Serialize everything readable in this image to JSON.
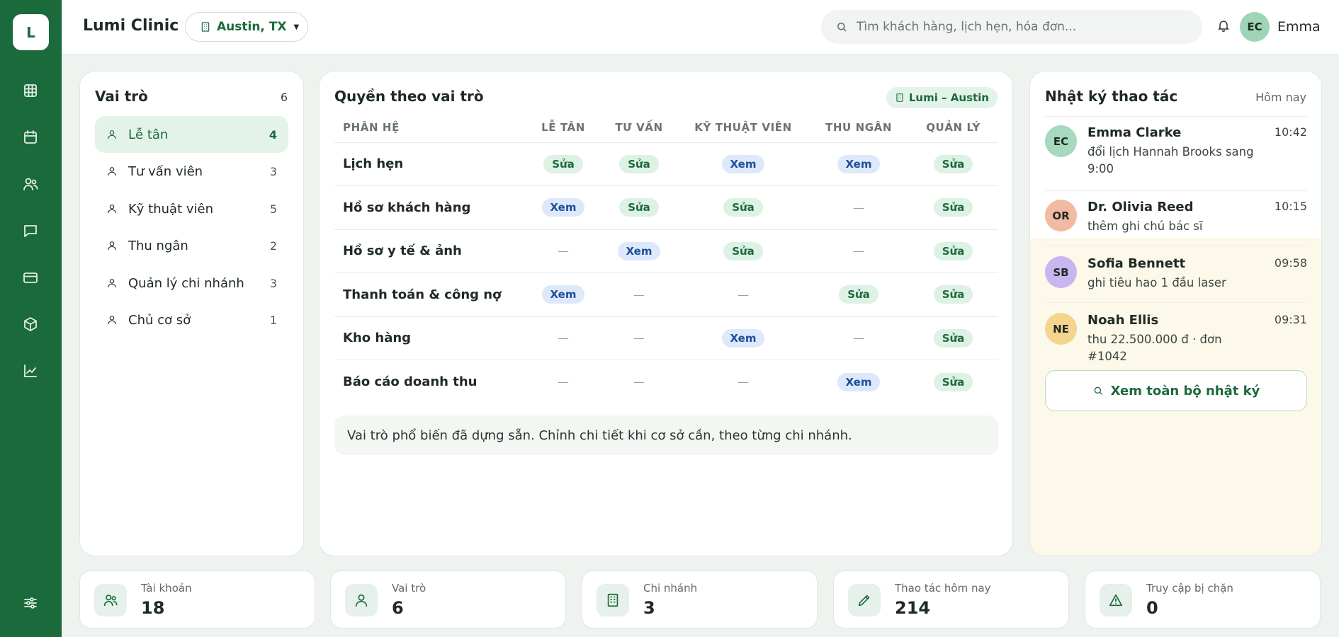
{
  "app": {
    "logo_letter": "L",
    "title": "Lumi Clinic"
  },
  "header": {
    "branch": "Austin, TX",
    "search_placeholder": "Tìm khách hàng, lịch hẹn, hóa đơn...",
    "user_initials": "EC",
    "user_name": "Emma"
  },
  "sidebar": {
    "items": [
      {
        "icon": "grid-icon"
      },
      {
        "icon": "calendar-icon"
      },
      {
        "icon": "users-icon"
      },
      {
        "icon": "chat-icon"
      },
      {
        "icon": "card-icon"
      },
      {
        "icon": "box-icon"
      },
      {
        "icon": "chart-icon"
      },
      {
        "icon": "settings-sliders-icon"
      }
    ]
  },
  "roles": {
    "title": "Vai trò",
    "count": "6",
    "items": [
      {
        "label": "Lễ tân",
        "count": "4",
        "active": true
      },
      {
        "label": "Tư vấn viên",
        "count": "3"
      },
      {
        "label": "Kỹ thuật viên",
        "count": "5"
      },
      {
        "label": "Thu ngân",
        "count": "2"
      },
      {
        "label": "Quản lý chi nhánh",
        "count": "3"
      },
      {
        "label": "Chủ cơ sở",
        "count": "1"
      }
    ]
  },
  "permissions": {
    "title": "Quyền theo vai trò",
    "branch_badge": "Lumi – Austin",
    "columns": [
      "PHÂN HỆ",
      "LỄ TÂN",
      "TƯ VẤN",
      "KỸ THUẬT VIÊN",
      "THU NGÂN",
      "QUẢN LÝ"
    ],
    "rows": [
      {
        "module": "Lịch hẹn",
        "cells": [
          "Sửa",
          "Sửa",
          "Xem",
          "Xem",
          "Sửa"
        ]
      },
      {
        "module": "Hồ sơ khách hàng",
        "cells": [
          "Xem",
          "Sửa",
          "Sửa",
          "—",
          "Sửa"
        ]
      },
      {
        "module": "Hồ sơ y tế & ảnh",
        "cells": [
          "—",
          "Xem",
          "Sửa",
          "—",
          "Sửa"
        ]
      },
      {
        "module": "Thanh toán & công nợ",
        "cells": [
          "Xem",
          "—",
          "—",
          "Sửa",
          "Sửa"
        ]
      },
      {
        "module": "Kho hàng",
        "cells": [
          "—",
          "—",
          "Xem",
          "—",
          "Sửa"
        ]
      },
      {
        "module": "Báo cáo doanh thu",
        "cells": [
          "—",
          "—",
          "—",
          "Xem",
          "Sửa"
        ]
      }
    ],
    "note": "Vai trò phổ biến đã dựng sẵn. Chỉnh chi tiết khi cơ sở cần, theo từng chi nhánh."
  },
  "log": {
    "title": "Nhật ký thao tác",
    "period": "Hôm nay",
    "entries": [
      {
        "initials": "EC",
        "name": "Emma Clarke",
        "time": "10:42",
        "text": "đổi lịch Hannah Brooks sang 9:00",
        "color": "#a6d9bd"
      },
      {
        "initials": "OR",
        "name": "Dr. Olivia Reed",
        "time": "10:15",
        "text": "thêm ghi chú bác sĩ",
        "color": "#f2b9a3"
      },
      {
        "initials": "SB",
        "name": "Sofia Bennett",
        "time": "09:58",
        "text": "ghi tiêu hao 1 đầu laser",
        "color": "#c9b6ee"
      },
      {
        "initials": "NE",
        "name": "Noah Ellis",
        "time": "09:31",
        "text": "thu 22.500.000 đ · đơn #1042",
        "color": "#f5d58e"
      }
    ],
    "button": "Xem toàn bộ nhật ký"
  },
  "stats": [
    {
      "icon": "users-icon",
      "label": "Tài khoản",
      "value": "18"
    },
    {
      "icon": "user-icon",
      "label": "Vai trò",
      "value": "6"
    },
    {
      "icon": "building-icon",
      "label": "Chi nhánh",
      "value": "3"
    },
    {
      "icon": "pencil-icon",
      "label": "Thao tác hôm nay",
      "value": "214"
    },
    {
      "icon": "warning-icon",
      "label": "Truy cập bị chặn",
      "value": "0"
    }
  ],
  "colors": {
    "brand": "#1b6a3b",
    "edit_pill": "#ddf1e4",
    "view_pill": "#dde9fa"
  }
}
